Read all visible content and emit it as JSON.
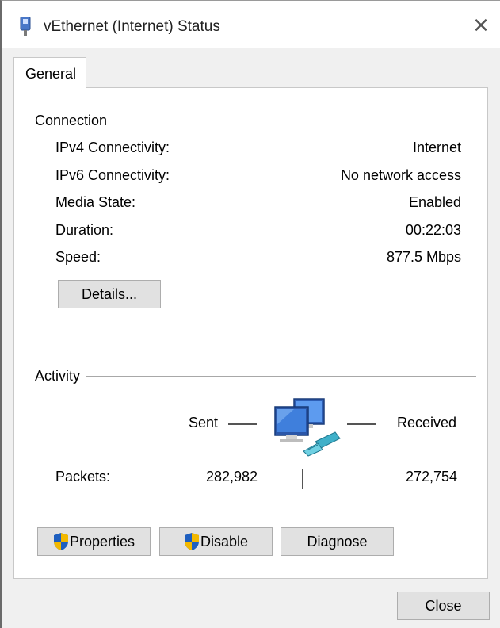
{
  "window": {
    "title": "vEthernet (Internet) Status",
    "title_icon": "network-adapter-icon",
    "close_glyph": "✕"
  },
  "tabs": [
    {
      "label": "General",
      "selected": true
    }
  ],
  "connection": {
    "group_label": "Connection",
    "rows": [
      {
        "label": "IPv4 Connectivity:",
        "value": "Internet"
      },
      {
        "label": "IPv6 Connectivity:",
        "value": "No network access"
      },
      {
        "label": "Media State:",
        "value": "Enabled"
      },
      {
        "label": "Duration:",
        "value": "00:22:03"
      },
      {
        "label": "Speed:",
        "value": "877.5 Mbps"
      }
    ],
    "details_button": "Details..."
  },
  "activity": {
    "group_label": "Activity",
    "sent_label": "Sent",
    "received_label": "Received",
    "packets_label": "Packets:",
    "sent_packets": "282,982",
    "received_packets": "272,754",
    "icon": "network-computers-icon"
  },
  "buttons": {
    "properties": "Properties",
    "disable": "Disable",
    "diagnose": "Diagnose",
    "close": "Close"
  },
  "colors": {
    "shield_blue": "#1e5fbf",
    "shield_yellow": "#f2b800",
    "button_face": "#e1e1e1",
    "dialog_bg": "#f0f0f0"
  }
}
